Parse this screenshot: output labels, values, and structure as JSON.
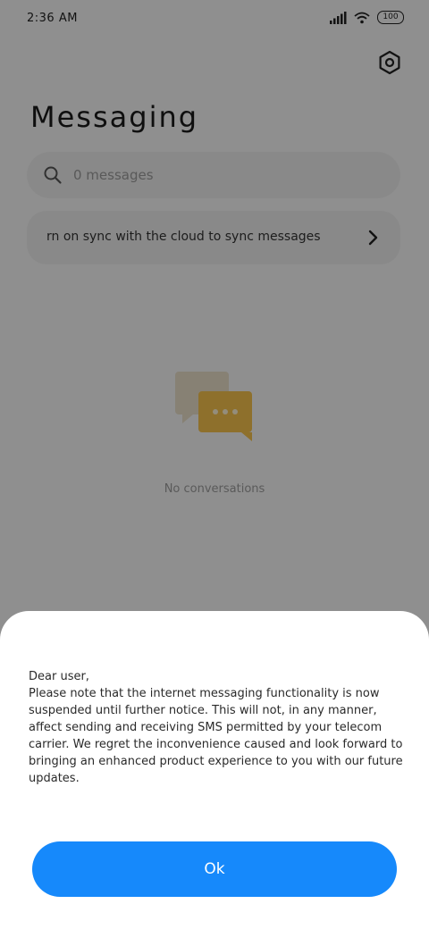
{
  "status_bar": {
    "time": "2:36 AM",
    "battery": "100",
    "icons": [
      "signal-icon",
      "wifi-icon",
      "battery-icon"
    ]
  },
  "header": {
    "title": "Messaging",
    "settings_icon": "gear-icon"
  },
  "search": {
    "placeholder": "0 messages",
    "icon": "search-icon"
  },
  "sync_banner": {
    "text": "rn on sync with the cloud to sync messages",
    "icon": "chevron-right-icon"
  },
  "empty_state": {
    "text": "No conversations",
    "icon": "chat-bubbles-icon"
  },
  "dialog": {
    "greeting": "Dear user,",
    "body": "Please note that the internet messaging functionality is now suspended until further notice. This will not, in any manner, affect sending and receiving SMS permitted by your telecom carrier. We regret the inconvenience caused and look forward to bringing an enhanced product experience to you with our future updates.",
    "ok_label": "Ok"
  },
  "colors": {
    "primary_button": "#1689fb",
    "empty_icon_accent": "#f5c24d"
  }
}
